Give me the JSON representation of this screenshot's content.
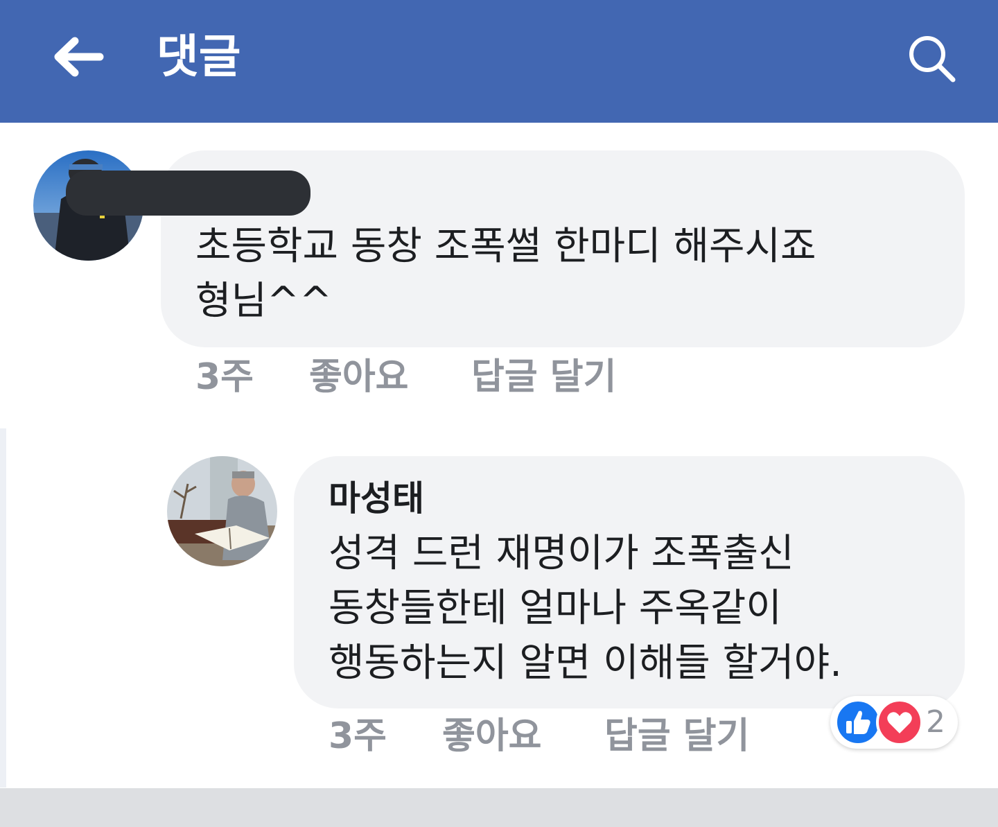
{
  "header": {
    "title": "댓글",
    "back_icon": "back-arrow-icon",
    "search_icon": "search-icon",
    "background": "#4267b2"
  },
  "comments": [
    {
      "author": "",
      "text_lines": [
        "초등학교 동창 조폭썰 한마디 해주시죠",
        "형님^^"
      ],
      "time": "3주",
      "like_label": "좋아요",
      "reply_label": "답글 달기"
    },
    {
      "author": "마성태",
      "text_lines": [
        "성격 드런 재명이가 조폭출신",
        "동창들한테 얼마나 주옥같이",
        "행동하는지 알면 이해들 할거야."
      ],
      "time": "3주",
      "like_label": "좋아요",
      "reply_label": "답글 달기",
      "reactions": {
        "icons": [
          "like-icon",
          "love-icon"
        ],
        "count": "2"
      }
    }
  ],
  "colors": {
    "bubble": "#f2f3f5",
    "meta_text": "#90949c",
    "like_blue": "#1877f2",
    "love_red": "#f33e58"
  }
}
